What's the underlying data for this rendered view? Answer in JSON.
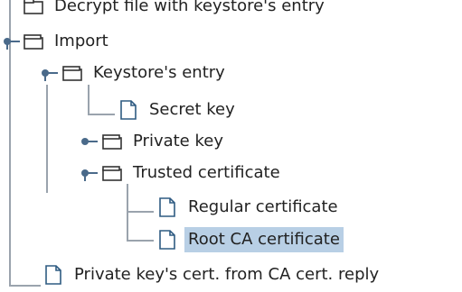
{
  "tree": {
    "top_item_label": "Decrypt file with keystore's entry",
    "import_label": "Import",
    "keystore_entry_label": "Keystore's entry",
    "secret_key_label": "Secret key",
    "private_key_label": "Private key",
    "trusted_certificate_label": "Trusted certificate",
    "regular_certificate_label": "Regular certificate",
    "root_ca_certificate_label": "Root CA certificate",
    "private_key_cert_reply_label": "Private key's cert. from CA cert. reply",
    "selected_item": "Root CA certificate"
  },
  "icons": {
    "folder": "folder-icon",
    "file": "file-icon",
    "expand_toggle": "expand-toggle-icon"
  },
  "colors": {
    "guide_line": "#9aa3ad",
    "toggle": "#4a6a8a",
    "selection": "#b8cfe5"
  }
}
